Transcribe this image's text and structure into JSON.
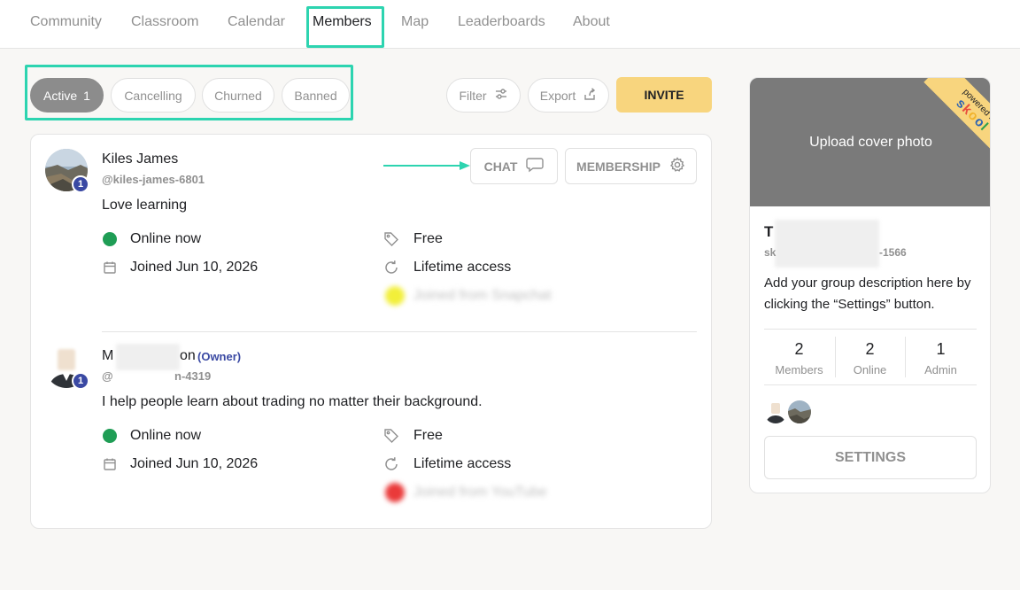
{
  "nav": {
    "tabs": [
      "Community",
      "Classroom",
      "Calendar",
      "Members",
      "Map",
      "Leaderboards",
      "About"
    ],
    "active": "Members"
  },
  "filters": {
    "pills": [
      {
        "label": "Active",
        "count": "1"
      },
      {
        "label": "Cancelling"
      },
      {
        "label": "Churned"
      },
      {
        "label": "Banned"
      }
    ],
    "filter_label": "Filter",
    "export_label": "Export",
    "invite_label": "INVITE"
  },
  "members": [
    {
      "name": "Kiles James",
      "handle": "@kiles-james-6801",
      "level": "1",
      "bio": "Love learning",
      "status": "Online now",
      "joined": "Joined Jun 10, 2026",
      "price": "Free",
      "access": "Lifetime access",
      "source": "Joined from Snapchat",
      "chat_label": "CHAT",
      "membership_label": "MEMBERSHIP"
    },
    {
      "name_start": "M",
      "name_end": "on",
      "owner_tag": "(Owner)",
      "handle_start": "@",
      "handle_end": "n-4319",
      "level": "1",
      "bio": "I help people learn about trading no matter their background.",
      "status": "Online now",
      "joined": "Joined Jun 10, 2026",
      "price": "Free",
      "access": "Lifetime access",
      "source": "Joined from YouTube"
    }
  ],
  "sidebar": {
    "cover_label": "Upload cover photo",
    "ribbon_top": "powered by",
    "ribbon_brand": "skool",
    "group_name_start": "T",
    "group_url_start": "sk",
    "group_url_end": "-1566",
    "description": "Add your group description here by clicking the “Settings” button.",
    "stats": [
      {
        "value": "2",
        "label": "Members"
      },
      {
        "value": "2",
        "label": "Online"
      },
      {
        "value": "1",
        "label": "Admin"
      }
    ],
    "settings_label": "SETTINGS"
  },
  "colors": {
    "accent_highlight": "#2dd4b0",
    "invite_yellow": "#f8d57e",
    "online_green": "#1f9d55",
    "level_blue": "#3a49a3"
  }
}
